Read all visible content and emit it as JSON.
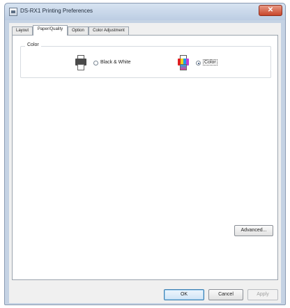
{
  "window": {
    "title": "DS-RX1 Printing Preferences",
    "close_label": "✕"
  },
  "tabs": [
    {
      "label": "Layout",
      "active": false
    },
    {
      "label": "Paper/Quality",
      "active": true
    },
    {
      "label": "Option",
      "active": false
    },
    {
      "label": "Color Adjustment",
      "active": false
    }
  ],
  "color_group": {
    "label": "Color",
    "options": [
      {
        "label": "Black & White",
        "selected": false
      },
      {
        "label": "Color",
        "selected": true
      }
    ]
  },
  "buttons": {
    "advanced": "Advanced...",
    "ok": "OK",
    "cancel": "Cancel",
    "apply": "Apply"
  }
}
